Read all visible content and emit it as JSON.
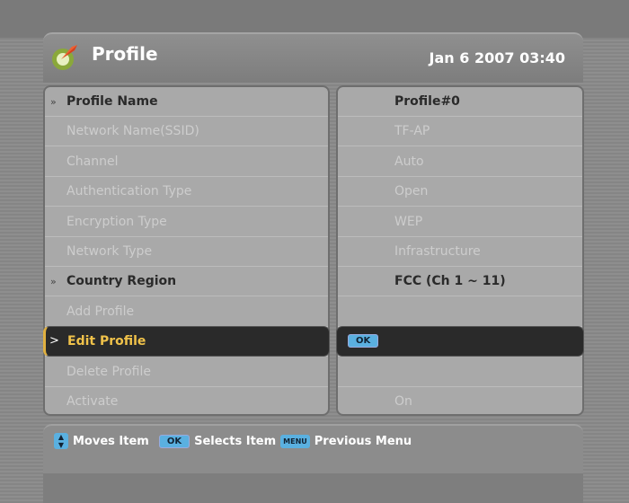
{
  "header": {
    "title": "Profile",
    "datetime": "Jan 6 2007 03:40",
    "icon": "satellite-dish-icon"
  },
  "rows": [
    {
      "label": "Profile Name",
      "value": "Profile#0",
      "enabled": true,
      "arrow": true
    },
    {
      "label": "Network Name(SSID)",
      "value": "TF-AP",
      "enabled": false
    },
    {
      "label": "Channel",
      "value": "Auto",
      "enabled": false
    },
    {
      "label": "Authentication Type",
      "value": "Open",
      "enabled": false
    },
    {
      "label": "Encryption Type",
      "value": "WEP",
      "enabled": false
    },
    {
      "label": "Network Type",
      "value": "Infrastructure",
      "enabled": false
    },
    {
      "label": "Country Region",
      "value": "FCC (Ch 1 ~ 11)",
      "enabled": true,
      "arrow": true
    },
    {
      "label": "Add Profile",
      "value": "",
      "enabled": false
    },
    {
      "label": "Edit Profile",
      "value": "OK",
      "enabled": true,
      "selected": true
    },
    {
      "label": "Delete Profile",
      "value": "",
      "enabled": false
    },
    {
      "label": "Activate",
      "value": "On",
      "enabled": false
    }
  ],
  "footer": {
    "moves": "Moves Item",
    "ok_key": "OK",
    "selects": "Selects Item",
    "menu_key": "MENU",
    "previous": "Previous Menu"
  },
  "colors": {
    "highlight_text": "#f0c24a",
    "key_button": "#5ab0e0"
  }
}
